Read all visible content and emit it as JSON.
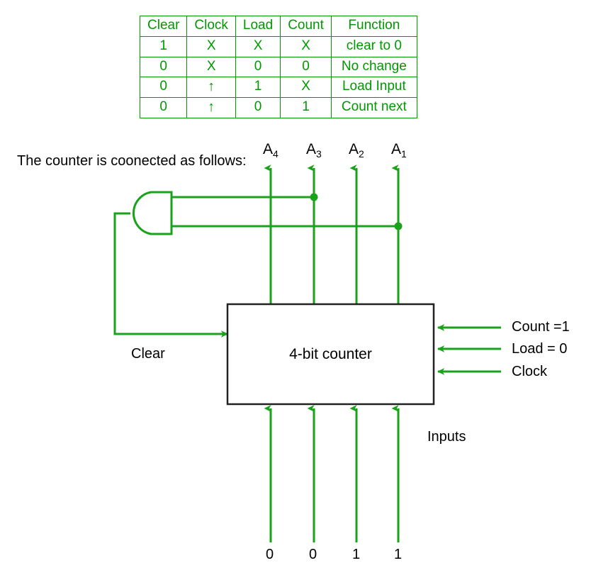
{
  "colors": {
    "wire_green": "#1aa31a",
    "table_green": "#009900",
    "text_black": "#000000",
    "box_border": "#222222",
    "background": "#ffffff"
  },
  "truth_table": {
    "headers": [
      "Clear",
      "Clock",
      "Load",
      "Count",
      "Function"
    ],
    "rows": [
      [
        "1",
        "X",
        "X",
        "X",
        "clear to 0"
      ],
      [
        "0",
        "X",
        "0",
        "0",
        "No change"
      ],
      [
        "0",
        "↑",
        "1",
        "X",
        "Load Input"
      ],
      [
        "0",
        "↑",
        "0",
        "1",
        "Count next"
      ]
    ]
  },
  "caption": {
    "text": "The counter is coonected as follows:"
  },
  "outputs": {
    "labels": [
      {
        "base": "A",
        "sub": "4"
      },
      {
        "base": "A",
        "sub": "3"
      },
      {
        "base": "A",
        "sub": "2"
      },
      {
        "base": "A",
        "sub": "1"
      }
    ]
  },
  "counter_box": {
    "title": "4-bit counter"
  },
  "control_inputs": {
    "items": [
      {
        "label": "Count =1"
      },
      {
        "label": "Load = 0"
      },
      {
        "label": "Clock"
      }
    ]
  },
  "clear_signal": {
    "label": "Clear"
  },
  "data_inputs": {
    "group_label": "Inputs",
    "values": [
      "0",
      "0",
      "1",
      "1"
    ]
  },
  "gate": {
    "type": "AND"
  }
}
